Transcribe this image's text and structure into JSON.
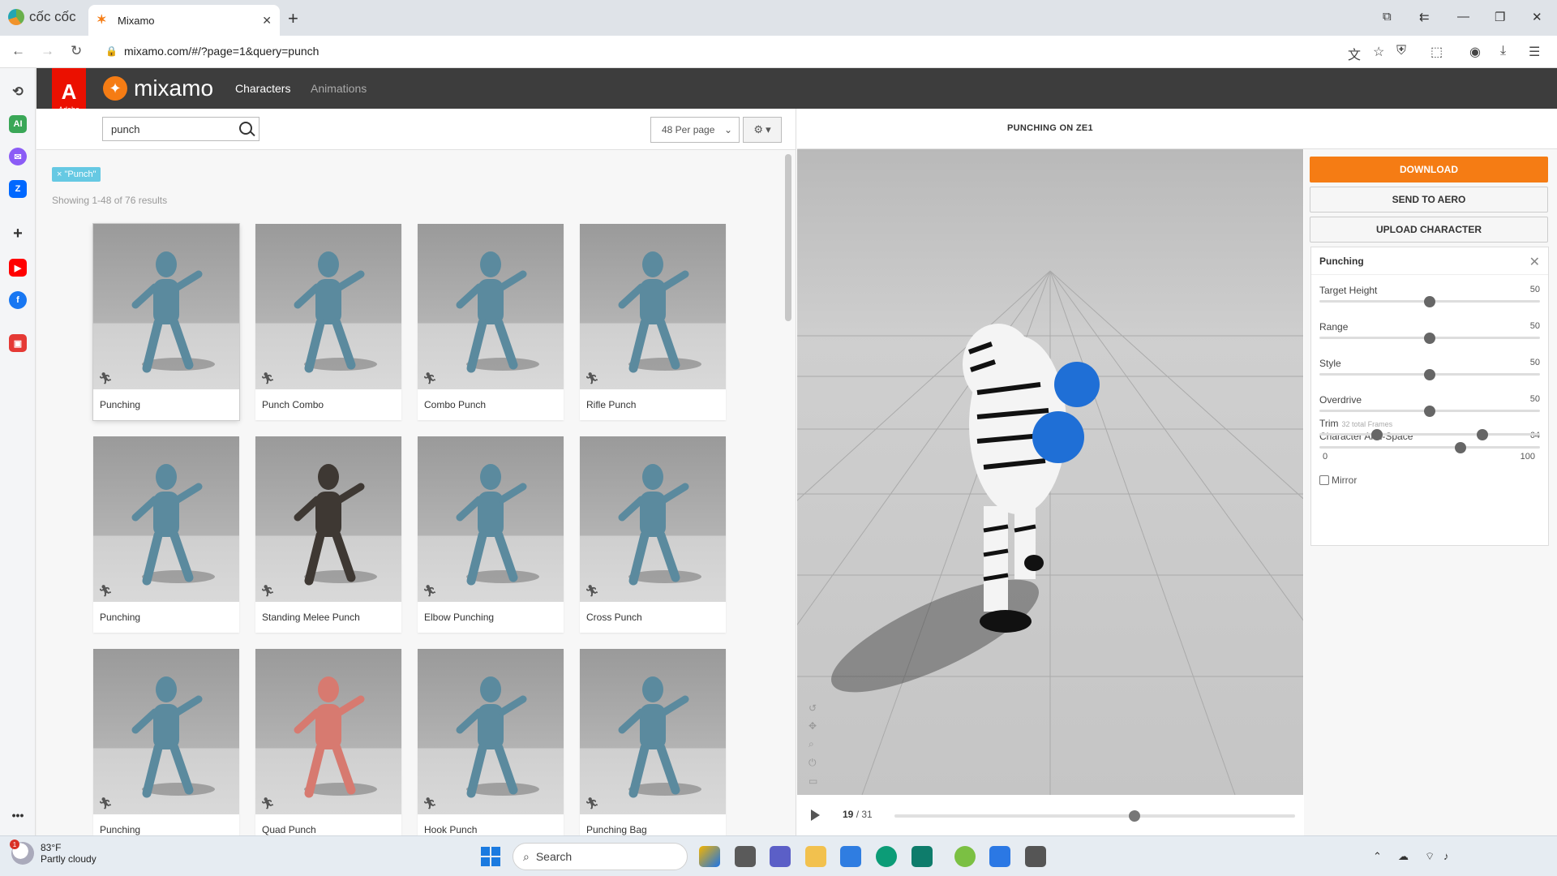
{
  "browser": {
    "brand": "cốc cốc",
    "tab_title": "Mixamo",
    "url": "mixamo.com/#/?page=1&query=punch"
  },
  "app": {
    "adobe_label": "Adobe",
    "logo_text": "mixamo",
    "nav": [
      "Characters",
      "Animations"
    ],
    "active_nav": "Characters"
  },
  "search": {
    "value": "punch",
    "per_page": "48 Per page",
    "filter_chip": "× \"Punch\"",
    "results": "Showing 1-48 of 76 results"
  },
  "cards": [
    {
      "label": "Punching",
      "figure_color": "#5b8a9e",
      "selected": true
    },
    {
      "label": "Punch Combo",
      "figure_color": "#5b8a9e"
    },
    {
      "label": "Combo Punch",
      "figure_color": "#5b8a9e"
    },
    {
      "label": "Rifle Punch",
      "figure_color": "#5b8a9e"
    },
    {
      "label": "Punching",
      "figure_color": "#5b8a9e"
    },
    {
      "label": "Standing Melee Punch",
      "figure_color": "#3e3833"
    },
    {
      "label": "Elbow Punching",
      "figure_color": "#5b8a9e"
    },
    {
      "label": "Cross Punch",
      "figure_color": "#5b8a9e"
    },
    {
      "label": "Punching",
      "figure_color": "#5b8a9e"
    },
    {
      "label": "Quad Punch",
      "figure_color": "#d77a70"
    },
    {
      "label": "Hook Punch",
      "figure_color": "#5b8a9e"
    },
    {
      "label": "Punching Bag",
      "figure_color": "#5b8a9e"
    }
  ],
  "viewer": {
    "title": "PUNCHING ON ZE1",
    "frame_current": "19",
    "frame_total": "/ 31",
    "timeline_fraction": 0.6
  },
  "panel": {
    "download": "DOWNLOAD",
    "send_to_aero": "SEND TO AERO",
    "upload_character": "UPLOAD CHARACTER",
    "title": "Punching",
    "sliders": [
      {
        "label": "Target Height",
        "value": "50",
        "fraction": 0.5
      },
      {
        "label": "Range",
        "value": "50",
        "fraction": 0.5
      },
      {
        "label": "Style",
        "value": "50",
        "fraction": 0.5
      },
      {
        "label": "Overdrive",
        "value": "50",
        "fraction": 0.5
      },
      {
        "label": "Character Arm-Space",
        "value": "64",
        "fraction": 0.64
      }
    ],
    "trim": {
      "label": "Trim",
      "sub": "32 total Frames",
      "min": "0",
      "max": "100",
      "low_fraction": 0.26,
      "high_fraction": 0.74
    },
    "mirror": "Mirror"
  },
  "taskbar": {
    "temp": "83°F",
    "weather": "Partly cloudy",
    "notify_count": "1",
    "search_placeholder": "Search"
  },
  "colors": {
    "accent": "#f57c14",
    "adobe_red": "#eb1000",
    "chip": "#66c9e3"
  }
}
